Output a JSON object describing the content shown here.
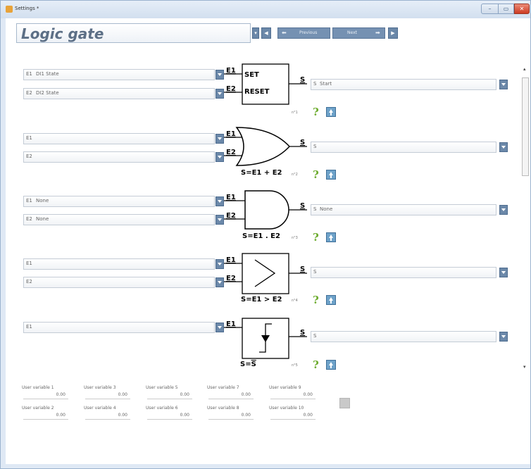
{
  "window": {
    "title": "Settings *",
    "controls": {
      "minimize": "–",
      "maximize": "▭",
      "close": "✕"
    }
  },
  "header": {
    "title": "Logic gate",
    "prev_label": "Previous",
    "next_label": "Next"
  },
  "gates": [
    {
      "id": "set-reset",
      "inputs": [
        {
          "label": "E1",
          "value": "DI1 State"
        },
        {
          "label": "E2",
          "value": "DI2 State"
        }
      ],
      "output": {
        "label": "S",
        "value": "Start"
      },
      "pins": {
        "e1": "E1",
        "e2": "E2",
        "s": "S"
      },
      "texts": {
        "set": "SET",
        "reset": "RESET"
      },
      "formula": "",
      "number": "n°1"
    },
    {
      "id": "or",
      "inputs": [
        {
          "label": "E1",
          "value": ""
        },
        {
          "label": "E2",
          "value": ""
        }
      ],
      "output": {
        "label": "S",
        "value": ""
      },
      "pins": {
        "e1": "E1",
        "e2": "E2",
        "s": "S"
      },
      "formula": "S=E1 + E2",
      "number": "n°2"
    },
    {
      "id": "and",
      "inputs": [
        {
          "label": "E1",
          "value": "None"
        },
        {
          "label": "E2",
          "value": "None"
        }
      ],
      "output": {
        "label": "S",
        "value": "None"
      },
      "pins": {
        "e1": "E1",
        "e2": "E2",
        "s": "S"
      },
      "formula": "S=E1 . E2",
      "number": "n°3"
    },
    {
      "id": "greater",
      "inputs": [
        {
          "label": "E1",
          "value": ""
        },
        {
          "label": "E2",
          "value": ""
        }
      ],
      "output": {
        "label": "S",
        "value": ""
      },
      "pins": {
        "e1": "E1",
        "e2": "E2",
        "s": "S"
      },
      "formula": "S=E1 > E2",
      "number": "n°4"
    },
    {
      "id": "edge",
      "inputs": [
        {
          "label": "E1",
          "value": ""
        }
      ],
      "output": {
        "label": "S",
        "value": ""
      },
      "pins": {
        "e1": "E1",
        "s": "S"
      },
      "formula_prefix": "S=",
      "formula_overline": "S",
      "number": "n°5"
    }
  ],
  "help_symbol": "?",
  "user_variables": [
    {
      "label": "User variable 1",
      "value": "0.00"
    },
    {
      "label": "User variable 2",
      "value": "0.00"
    },
    {
      "label": "User variable 3",
      "value": "0.00"
    },
    {
      "label": "User variable 4",
      "value": "0.00"
    },
    {
      "label": "User variable 5",
      "value": "0.00"
    },
    {
      "label": "User variable 6",
      "value": "0.00"
    },
    {
      "label": "User variable 7",
      "value": "0.00"
    },
    {
      "label": "User variable 8",
      "value": "0.00"
    },
    {
      "label": "User variable 9",
      "value": "0.00"
    },
    {
      "label": "User variable 10",
      "value": "0.00"
    }
  ],
  "colors": {
    "accent": "#6b88a9",
    "help": "#6cab2d",
    "title": "#5c6f86"
  }
}
